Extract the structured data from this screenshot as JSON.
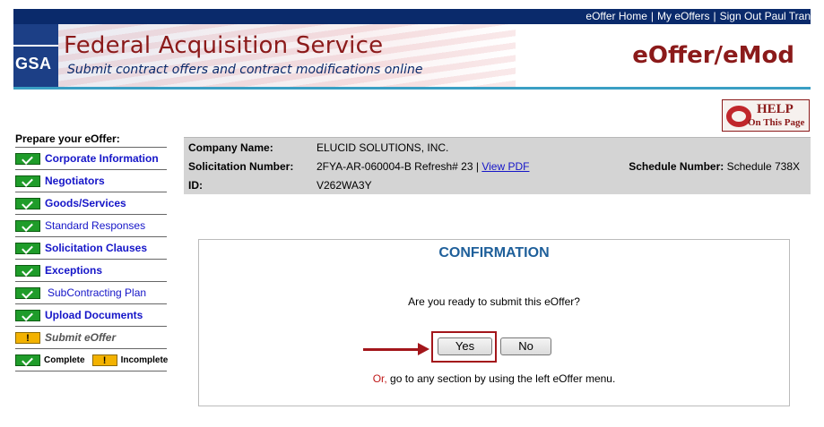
{
  "nav": {
    "links": [
      "eOffer Home",
      "My eOffers",
      "Sign Out Paul Tran"
    ],
    "separator": "|"
  },
  "header": {
    "logo_text": "GSA",
    "title": "Federal Acquisition Service",
    "subtitle": "Submit contract offers and contract modifications online",
    "product": "eOffer/eMod",
    "brand_color": "#8b1a1a",
    "nav_color": "#0a2a6b",
    "rule_color": "#3a9fc4"
  },
  "help": {
    "line1": "HELP",
    "line2": "On This Page",
    "icon": "life-ring-icon"
  },
  "sidebar": {
    "heading": "Prepare your eOffer:",
    "items": [
      {
        "label": "Corporate Information",
        "status": "complete"
      },
      {
        "label": "Negotiators",
        "status": "complete"
      },
      {
        "label": "Goods/Services",
        "status": "complete"
      },
      {
        "label": "Standard Responses",
        "status": "complete"
      },
      {
        "label": "Solicitation Clauses",
        "status": "complete"
      },
      {
        "label": "Exceptions",
        "status": "complete"
      },
      {
        "label": "SubContracting Plan",
        "status": "complete"
      },
      {
        "label": "Upload Documents",
        "status": "complete"
      },
      {
        "label": "Submit eOffer",
        "status": "incomplete"
      }
    ],
    "legend": {
      "complete": "Complete",
      "incomplete": "Incomplete",
      "warn_glyph": "!"
    }
  },
  "company": {
    "name_label": "Company Name:",
    "name": "ELUCID SOLUTIONS, INC.",
    "solicitation_label": "Solicitation Number:",
    "solicitation": "2FYA-AR-060004-B Refresh# 23 |",
    "view_pdf": "View PDF",
    "schedule_label": "Schedule Number:",
    "schedule": "Schedule 738X",
    "id_label": "ID:",
    "id": "V262WA3Y"
  },
  "confirmation": {
    "title": "CONFIRMATION",
    "question": "Are you ready to submit this eOffer?",
    "yes": "Yes",
    "no": "No",
    "or": "Or,",
    "hint": "go to any section by using the left eOffer menu.",
    "highlight_color": "#a3161b"
  }
}
